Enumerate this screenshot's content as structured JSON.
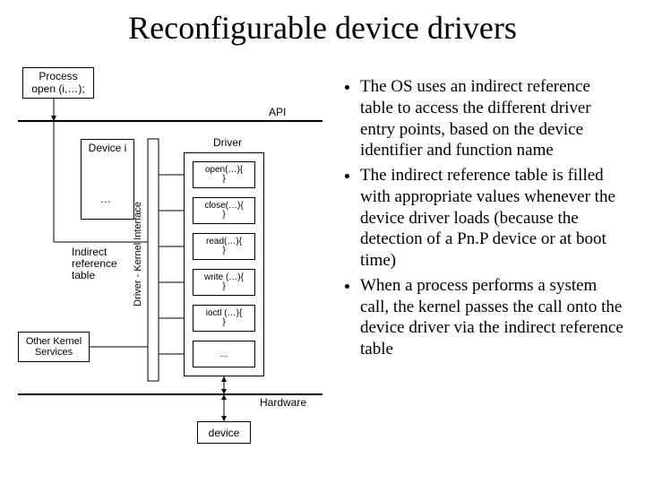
{
  "title": "Reconfigurable device drivers",
  "bullets": [
    "The OS uses an indirect reference table to access the different driver entry points, based on the device identifier and function name",
    "The indirect reference table is filled with appropriate values whenever the device driver loads (because the detection of a Pn.P device or at boot time)",
    "When a process performs a system call, the kernel passes the call onto the device driver via the indirect reference table"
  ],
  "diagram": {
    "process_box": "Process\nopen (i,…);",
    "api_label": "API",
    "device_i": "Device i",
    "driver_label": "Driver",
    "funcs": [
      "open(…){\n}",
      "close(…){\n}",
      "read(…){\n}",
      "write (…){\n}",
      "ioctl (…){\n}",
      "..."
    ],
    "indirect_label": "Indirect\nreference\ntable",
    "other_kernel": "Other Kernel\nServices",
    "dki_label": "Driver - Kernel Interface",
    "hardware_label": "Hardware",
    "device_box": "device",
    "ellipsis": "…"
  }
}
